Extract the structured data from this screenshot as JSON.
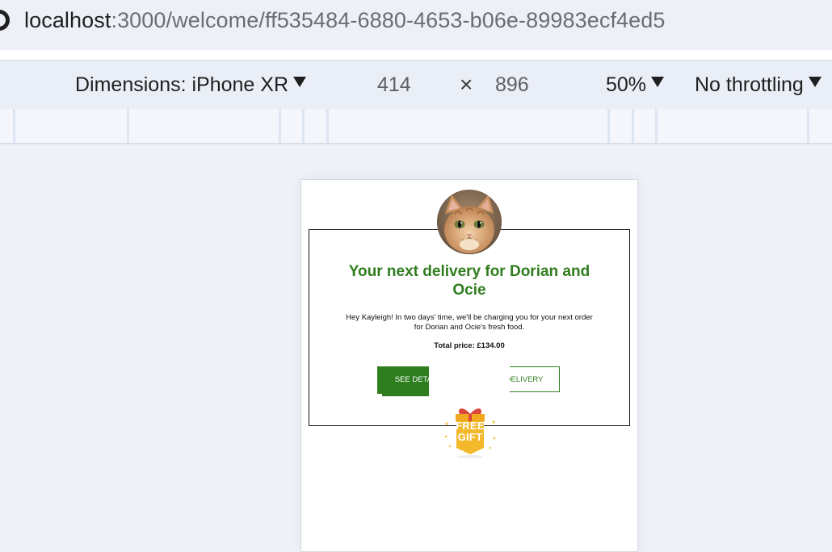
{
  "address_bar": {
    "host": "localhost",
    "path": ":3000/welcome/ff535484-6880-4653-b06e-89983ecf4ed5"
  },
  "device_toolbar": {
    "dimensions_label": "Dimensions: iPhone XR",
    "width": "414",
    "times": "×",
    "height": "896",
    "zoom": "50%",
    "throttling": "No throttling"
  },
  "email": {
    "heading": "Your next delivery for Dorian and Ocie",
    "message": "Hey Kayleigh! In two days' time, we'll be charging you for your next order for Dorian and Ocie's fresh food.",
    "total_price": "Total price: £134.00",
    "see_details_label": "SEE DETAILS",
    "edit_delivery_label": "EDIT DELIVERY",
    "gift_line1": "FREE",
    "gift_line2": "GIFT"
  },
  "colors": {
    "brand_green": "#2e7d1f",
    "gift_yellow": "#f4b92b",
    "ribbon_red": "#d9463b"
  },
  "icons": [
    "dropdown-caret-icon",
    "cat-avatar-image",
    "free-gift-icon"
  ]
}
